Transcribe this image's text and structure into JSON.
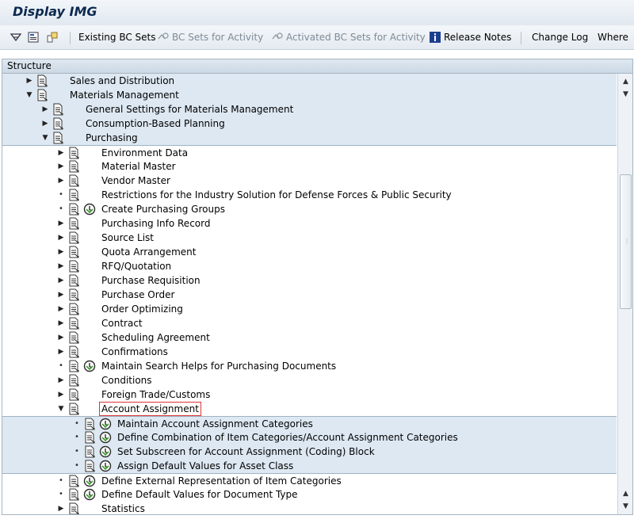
{
  "window": {
    "title": "Display IMG"
  },
  "toolbar": {
    "existing_bc_sets": "Existing BC Sets",
    "bc_sets_for_activity": "BC Sets for Activity",
    "activated_bc_sets_for_activity": "Activated BC Sets for Activity",
    "release_notes": "Release Notes",
    "change_log": "Change Log",
    "where": "Where"
  },
  "structure": {
    "header": "Structure",
    "rows": [
      {
        "label": "Sales and Distribution",
        "level": 0,
        "state": "collapsed",
        "band": true,
        "activity": false
      },
      {
        "label": "Materials Management",
        "level": 0,
        "state": "expanded",
        "band": true,
        "activity": false
      },
      {
        "label": "General Settings for Materials Management",
        "level": 1,
        "state": "collapsed",
        "band": true,
        "activity": false
      },
      {
        "label": "Consumption-Based Planning",
        "level": 1,
        "state": "collapsed",
        "band": true,
        "activity": false
      },
      {
        "label": "Purchasing",
        "level": 1,
        "state": "expanded",
        "band": true,
        "activity": false
      },
      {
        "label": "Environment Data",
        "level": 2,
        "state": "collapsed",
        "band": false,
        "activity": false
      },
      {
        "label": "Material Master",
        "level": 2,
        "state": "collapsed",
        "band": false,
        "activity": false
      },
      {
        "label": "Vendor Master",
        "level": 2,
        "state": "collapsed",
        "band": false,
        "activity": false
      },
      {
        "label": "Restrictions for the Industry Solution for Defense Forces & Public Security",
        "level": 2,
        "state": "leaf",
        "band": false,
        "activity": false
      },
      {
        "label": "Create Purchasing Groups",
        "level": 2,
        "state": "leaf",
        "band": false,
        "activity": true
      },
      {
        "label": "Purchasing Info Record",
        "level": 2,
        "state": "collapsed",
        "band": false,
        "activity": false
      },
      {
        "label": "Source List",
        "level": 2,
        "state": "collapsed",
        "band": false,
        "activity": false
      },
      {
        "label": "Quota Arrangement",
        "level": 2,
        "state": "collapsed",
        "band": false,
        "activity": false
      },
      {
        "label": "RFQ/Quotation",
        "level": 2,
        "state": "collapsed",
        "band": false,
        "activity": false
      },
      {
        "label": "Purchase Requisition",
        "level": 2,
        "state": "collapsed",
        "band": false,
        "activity": false
      },
      {
        "label": "Purchase Order",
        "level": 2,
        "state": "collapsed",
        "band": false,
        "activity": false
      },
      {
        "label": "Order Optimizing",
        "level": 2,
        "state": "collapsed",
        "band": false,
        "activity": false
      },
      {
        "label": "Contract",
        "level": 2,
        "state": "collapsed",
        "band": false,
        "activity": false
      },
      {
        "label": "Scheduling Agreement",
        "level": 2,
        "state": "collapsed",
        "band": false,
        "activity": false
      },
      {
        "label": "Confirmations",
        "level": 2,
        "state": "collapsed",
        "band": false,
        "activity": false
      },
      {
        "label": "Maintain Search Helps for Purchasing Documents",
        "level": 2,
        "state": "leaf",
        "band": false,
        "activity": true
      },
      {
        "label": "Conditions",
        "level": 2,
        "state": "collapsed",
        "band": false,
        "activity": false
      },
      {
        "label": "Foreign Trade/Customs",
        "level": 2,
        "state": "collapsed",
        "band": false,
        "activity": false
      },
      {
        "label": "Account Assignment",
        "level": 2,
        "state": "expanded",
        "band": false,
        "activity": false,
        "focused": true
      },
      {
        "label": "Maintain Account Assignment Categories",
        "level": 3,
        "state": "leaf",
        "band": true,
        "activity": true
      },
      {
        "label": "Define Combination of Item Categories/Account Assignment Categories",
        "level": 3,
        "state": "leaf",
        "band": true,
        "activity": true
      },
      {
        "label": "Set Subscreen for Account Assignment (Coding) Block",
        "level": 3,
        "state": "leaf",
        "band": true,
        "activity": true
      },
      {
        "label": "Assign Default Values for Asset Class",
        "level": 3,
        "state": "leaf",
        "band": true,
        "activity": true
      },
      {
        "label": "Define External Representation of Item Categories",
        "level": 2,
        "state": "leaf",
        "band": false,
        "activity": true
      },
      {
        "label": "Define Default Values for Document Type",
        "level": 2,
        "state": "leaf",
        "band": false,
        "activity": true
      },
      {
        "label": "Statistics",
        "level": 2,
        "state": "collapsed",
        "band": false,
        "activity": false
      }
    ]
  },
  "colors": {
    "band": "#dde8f2",
    "title": "#0c2a4f",
    "disabled": "#7f8b96",
    "focus_outline": "#dd3333"
  },
  "icons": {
    "toolbar": [
      "filter-icon",
      "info-screen-icon",
      "tree-icon",
      "bc-set-icon",
      "release-notes-icon"
    ],
    "row": [
      "expand-arrow-icon",
      "collapse-arrow-icon",
      "bullet-icon",
      "document-icon",
      "clock-execute-icon"
    ]
  }
}
